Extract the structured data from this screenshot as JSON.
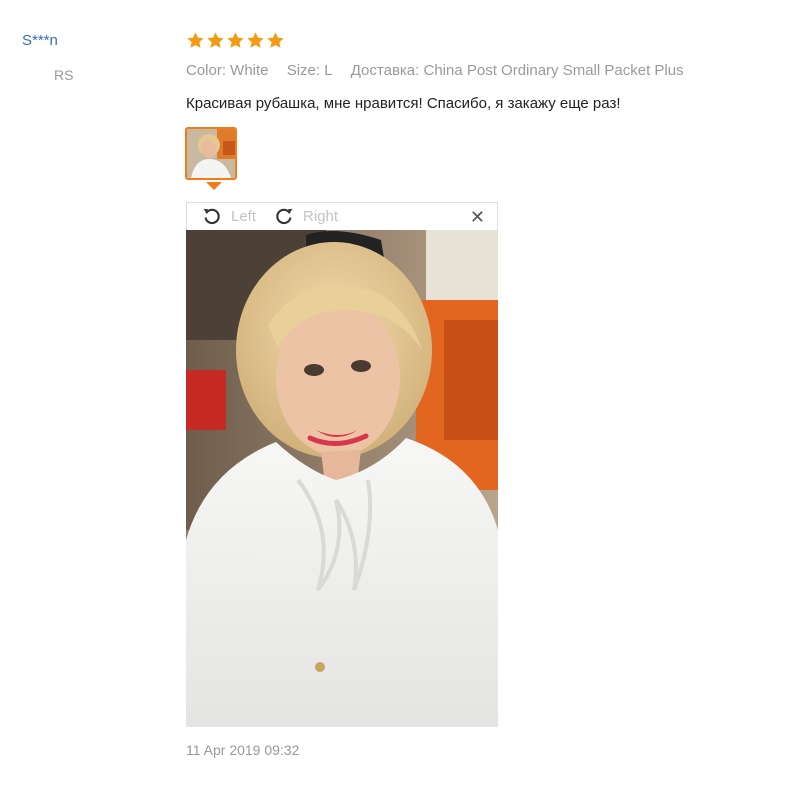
{
  "reviewer": {
    "name": "S***n",
    "country": "RS"
  },
  "rating": {
    "stars": 5,
    "max": 5,
    "color": "#f39c12"
  },
  "meta": {
    "color_attr": "Color: White",
    "size_attr": "Size: L",
    "shipping": "Доставка: China Post Ordinary Small Packet Plus"
  },
  "review": {
    "text": "Красивая рубашка, мне нравится! Спасибо, я закажу еще раз!"
  },
  "viewer": {
    "left_label": "Left",
    "right_label": "Right",
    "close_label": "✕"
  },
  "footer": {
    "date": "11 Apr 2019 09:32"
  },
  "colors": {
    "accent": "#f07c1c",
    "link": "#3a6db3"
  }
}
